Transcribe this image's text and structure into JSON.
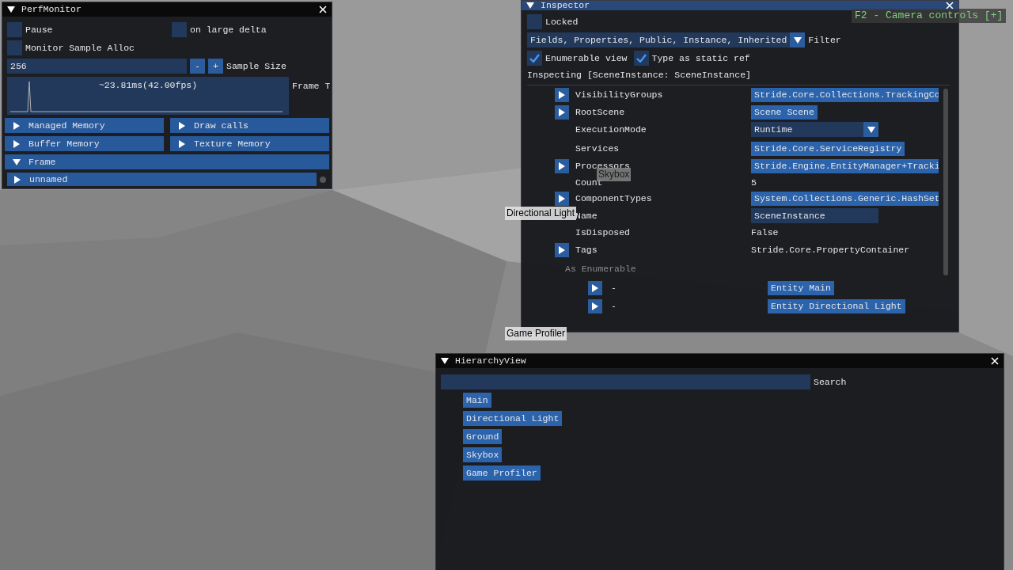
{
  "overlay_hint": "F2 - Camera controls [+]",
  "scene_labels": [
    {
      "text": "Skybox",
      "kind": "faint"
    },
    {
      "text": "Directional Light",
      "kind": "plain"
    },
    {
      "text": "Game Profiler",
      "kind": "plain"
    }
  ],
  "perf_monitor": {
    "title": "PerfMonitor",
    "checkboxes": [
      {
        "label": "Pause",
        "checked": false
      },
      {
        "label": "on large delta",
        "checked": false
      },
      {
        "label": "Monitor Sample Alloc",
        "checked": false
      }
    ],
    "sample_size": {
      "value": "256",
      "minus": "-",
      "plus": "+",
      "label": "Sample Size"
    },
    "plot": {
      "overlay": "~23.81ms(42.00fps)",
      "label": "Frame T"
    },
    "headers": [
      {
        "label": "Managed Memory",
        "expanded": false
      },
      {
        "label": "Draw calls",
        "expanded": false
      },
      {
        "label": "Buffer Memory",
        "expanded": false
      },
      {
        "label": "Texture Memory",
        "expanded": false
      },
      {
        "label": "Frame",
        "expanded": true
      }
    ],
    "frame_children": [
      {
        "label": "unnamed",
        "expanded": false
      }
    ]
  },
  "inspector": {
    "title": "Inspector",
    "locked": {
      "label": "Locked",
      "checked": false
    },
    "filter": {
      "value": "Fields, Properties, Public, Instance, Inherited",
      "label": "Filter"
    },
    "options": [
      {
        "label": "Enumerable view",
        "checked": true
      },
      {
        "label": "Type as static ref",
        "checked": true
      }
    ],
    "inspecting": "Inspecting [SceneInstance: SceneInstance]",
    "members": [
      {
        "name": "VisibilityGroups",
        "expandable": true,
        "kind": "button",
        "value": "Stride.Core.Collections.TrackingCo"
      },
      {
        "name": "RootScene",
        "expandable": true,
        "kind": "button",
        "value": "Scene Scene"
      },
      {
        "name": "ExecutionMode",
        "expandable": false,
        "kind": "combo",
        "value": "Runtime"
      },
      {
        "name": "Services",
        "expandable": false,
        "kind": "button",
        "value": "Stride.Core.ServiceRegistry"
      },
      {
        "name": "Processors",
        "expandable": true,
        "kind": "button",
        "value": "Stride.Engine.EntityManager+Tracki"
      },
      {
        "name": "Count",
        "expandable": false,
        "kind": "text",
        "value": "5"
      },
      {
        "name": "ComponentTypes",
        "expandable": true,
        "kind": "button",
        "value": "System.Collections.Generic.HashSet"
      },
      {
        "name": "Name",
        "expandable": false,
        "kind": "field",
        "value": "SceneInstance"
      },
      {
        "name": "IsDisposed",
        "expandable": false,
        "kind": "text",
        "value": "False"
      },
      {
        "name": "Tags",
        "expandable": true,
        "kind": "text",
        "value": "Stride.Core.PropertyContainer"
      }
    ],
    "enumerable_label": "As Enumerable",
    "enumerable": [
      {
        "name": "-",
        "value": "Entity Main"
      },
      {
        "name": "-",
        "value": "Entity Directional Light"
      }
    ]
  },
  "hierarchy": {
    "title": "HierarchyView",
    "search_label": "Search",
    "items": [
      "Main",
      "Directional Light",
      "Ground",
      "Skybox",
      "Game Profiler"
    ]
  }
}
